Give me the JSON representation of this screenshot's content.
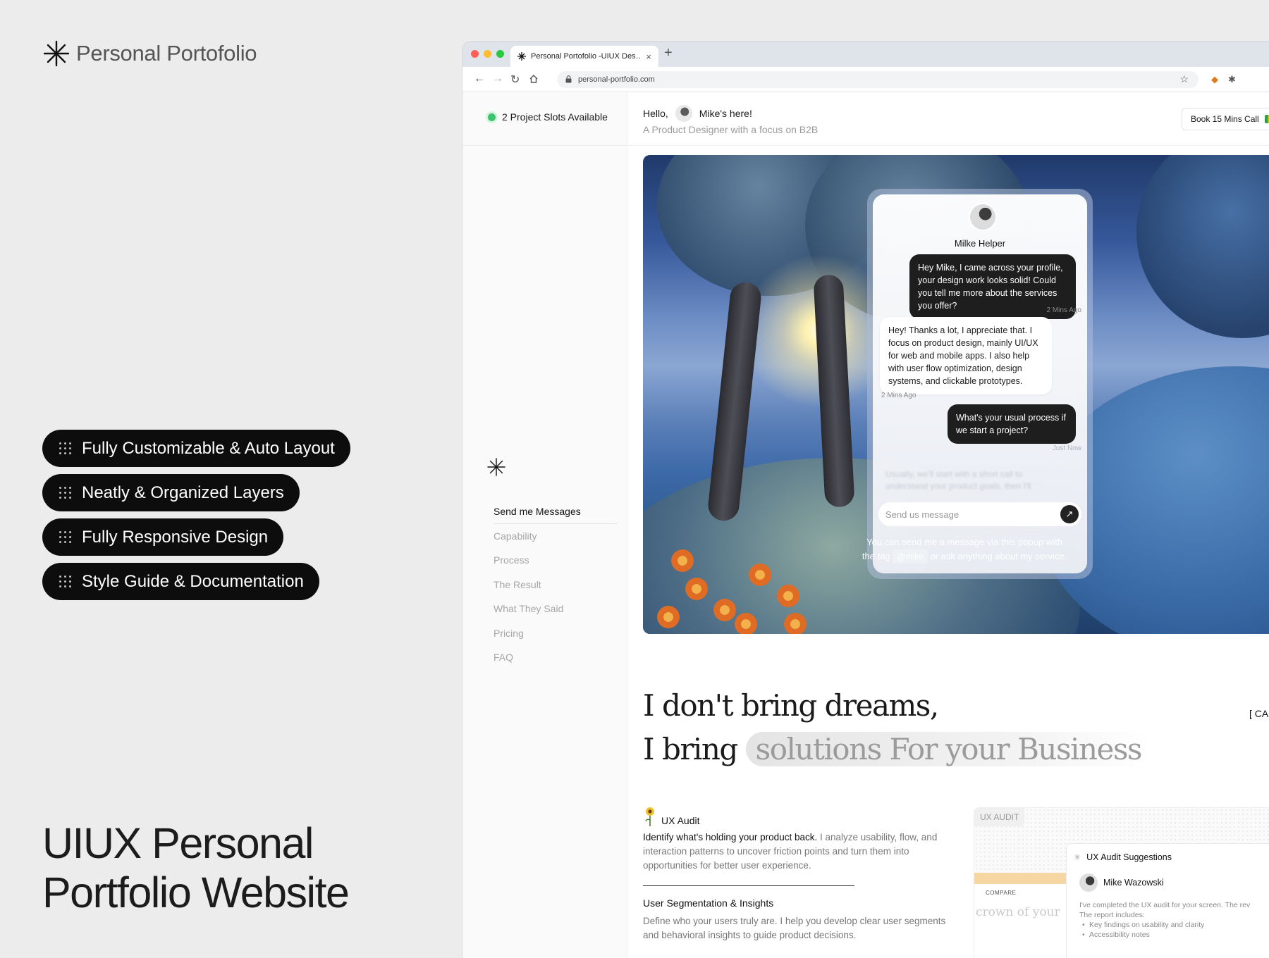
{
  "promo": {
    "brand": "Personal Portofolio",
    "features": [
      "Fully Customizable & Auto Layout",
      "Neatly & Organized Layers",
      "Fully Responsive Design",
      "Style Guide & Documentation"
    ],
    "headline_line1": "UIUX Personal",
    "headline_line2": "Portfolio Website"
  },
  "browser": {
    "tab_title": "Personal Portofolio -UIUX Des…",
    "tab_close": "×",
    "new_tab": "+",
    "url": "personal-portfolio.com"
  },
  "site": {
    "availability": "2 Project Slots Available",
    "greeting": "Hello,",
    "greeting_name": "Mike's here!",
    "tagline": "A Product Designer with a focus on B2B",
    "book_call": "Book 15 Mins Call",
    "nav": [
      "Send me Messages",
      "Capability",
      "Process",
      "The Result",
      "What They Said",
      "Pricing",
      "FAQ"
    ],
    "chat": {
      "name": "Milke Helper",
      "messages": [
        {
          "text": "Hey Mike, I came across your profile, your design work looks solid! Could you tell me more about the services you offer?",
          "time": "2 Mins Ago"
        },
        {
          "text": "Hey! Thanks a lot, I appreciate that. I focus on product design, mainly UI/UX for web and mobile apps. I also help with user flow optimization, design systems, and clickable prototypes.",
          "time": "2 Mins Ago"
        },
        {
          "text": "What's your usual process if we start a project?",
          "time": "Just Now"
        }
      ],
      "faded_text": "Usually, we'll start with a short call to understand your product goals, then I'll",
      "input_placeholder": "Send us message",
      "send_icon": "↗"
    },
    "hero_caption_1": "You can send me a message via this popup with",
    "hero_caption_2": "the tag",
    "hero_tag": "@mike",
    "hero_caption_3": "or ask anything about my service.",
    "statement_line1": "I don't bring dreams,",
    "statement_prefix": "I bring",
    "statement_highlight": "solutions For your Business",
    "cap_label": "[ CA",
    "service1": {
      "title": "UX Audit",
      "desc_strong": "Identify what's holding your product back.",
      "desc_rest": "I analyze usability, flow, and interaction patterns to uncover friction points and turn them into opportunities for better user experience."
    },
    "service2": {
      "title": "User Segmentation & Insights",
      "desc": "Define who your users truly are. I help you develop clear user segments and behavioral insights to guide product decisions."
    },
    "audit_card": {
      "label": "UX AUDIT",
      "compare": "COMPARE",
      "crown": "crown of your",
      "panel_title": "UX Audit Suggestions",
      "user": "Mike Wazowski",
      "body_line1": "I've completed the UX audit for your screen. The rev",
      "body_line2": "The report includes:",
      "bullets": [
        "Key findings on usability and clarity",
        "Accessibility notes"
      ]
    }
  },
  "colors": {
    "page_bg": "#ececec",
    "pill_bg": "#0d0d0d",
    "status_green": "#3cc46d",
    "bubble_dark": "#1e1e1e"
  }
}
